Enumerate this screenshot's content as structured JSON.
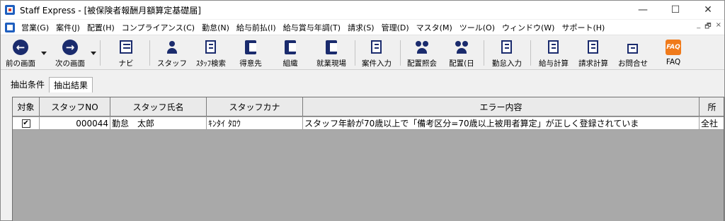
{
  "window": {
    "title": "Staff Express - [被保険者報酬月額算定基礎届]",
    "minimize": "—",
    "maximize": "☐",
    "close": "✕"
  },
  "menu": {
    "items": [
      {
        "label": "営業(G)"
      },
      {
        "label": "案件(J)"
      },
      {
        "label": "配置(H)"
      },
      {
        "label": "コンプライアンス(C)"
      },
      {
        "label": "勤怠(N)"
      },
      {
        "label": "給与前払(I)"
      },
      {
        "label": "給与賞与年調(T)"
      },
      {
        "label": "請求(S)"
      },
      {
        "label": "管理(D)"
      },
      {
        "label": "マスタ(M)"
      },
      {
        "label": "ツール(O)"
      },
      {
        "label": "ウィンドウ(W)"
      },
      {
        "label": "サポート(H)"
      }
    ],
    "mdi_minimize": "_",
    "mdi_restore": "🗗",
    "mdi_close": "×"
  },
  "toolbar": {
    "prev": "前の画面",
    "next": "次の画面",
    "navi": "ナビ",
    "staff": "スタッフ",
    "staff_search": "ｽﾀｯﾌ検索",
    "client": "得意先",
    "org": "組織",
    "site": "就業現場",
    "job_entry": "案件入力",
    "assign_inquiry": "配置照会",
    "assign": "配置(日",
    "attendance": "勤怠入力",
    "payroll": "給与計算",
    "billing": "請求計算",
    "contact": "お問合せ",
    "faq": "FAQ",
    "faq_icon_text": "FAQ"
  },
  "tabs": [
    {
      "label": "抽出条件"
    },
    {
      "label": "抽出結果"
    }
  ],
  "grid": {
    "headers": [
      "対象",
      "スタッフNO",
      "スタッフ氏名",
      "スタッフカナ",
      "エラー内容",
      "所"
    ],
    "rows": [
      {
        "checked": "✔",
        "staff_no": "000044",
        "name": "勤怠　太郎",
        "kana": "ｷﾝﾀｲ ﾀﾛｳ",
        "error": "スタッフ年齢が70歳以上で「備考区分=70歳以上被用者算定」が正しく登録されていま",
        "affiliation": "全社"
      }
    ]
  }
}
